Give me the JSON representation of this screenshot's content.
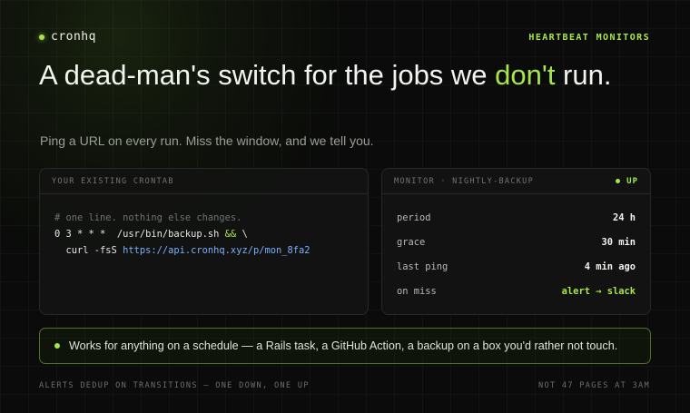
{
  "header": {
    "brand": "cronhq",
    "tag": "HEARTBEAT MONITORS"
  },
  "hero": {
    "headline_before": "A dead-man's switch for the jobs we ",
    "headline_accent": "don't",
    "headline_after": " run.",
    "subline": "Ping a URL on every run. Miss the window, and we tell you."
  },
  "crontab": {
    "title": "YOUR EXISTING CRONTAB",
    "comment": "# one line. nothing else changes.",
    "line1_cmd": "0 3 * * *  /usr/bin/backup.sh ",
    "line1_op": "&&",
    "line1_tail": " \\",
    "line2_cmd": "  curl -fsS ",
    "line2_url": "https://api.cronhq.xyz/p/mon_8fa2"
  },
  "monitor": {
    "title": "MONITOR · NIGHTLY-BACKUP",
    "status": "UP",
    "rows": [
      {
        "key": "period",
        "value": "24 h"
      },
      {
        "key": "grace",
        "value": "30 min"
      },
      {
        "key": "last ping",
        "value": "4 min ago"
      },
      {
        "key": "on miss",
        "value": "alert → slack"
      }
    ]
  },
  "banner": {
    "text": "Works for anything on a schedule — a Rails task, a GitHub Action, a backup on a box you'd rather not touch."
  },
  "footer": {
    "left": "ALERTS DEDUP ON TRANSITIONS — ONE DOWN, ONE UP",
    "right": "NOT 47 PAGES AT 3AM"
  },
  "colors": {
    "accent": "#a6e64a",
    "url": "#7ab0ff",
    "background": "#0a0b0a"
  }
}
